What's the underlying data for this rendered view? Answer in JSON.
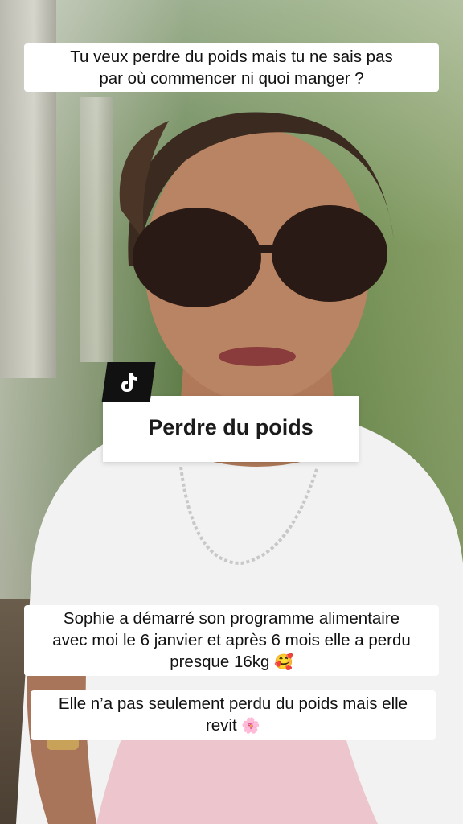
{
  "caption_top": {
    "line1": "Tu veux perdre du poids mais tu ne sais pas",
    "line2": "par où commencer ni quoi manger ?"
  },
  "tag": {
    "icon": "tiktok-icon",
    "label": "Perdre du poids"
  },
  "caption_mid": {
    "line1": "Sophie a démarré son programme alimentaire",
    "line2": "avec moi le 6 janvier et après 6 mois elle a perdu",
    "line3": "presque 16kg",
    "emoji": "🥰"
  },
  "caption_low": {
    "line1": "Elle n’a pas seulement perdu du poids mais elle",
    "line2": "revit",
    "emoji": "🌸"
  }
}
